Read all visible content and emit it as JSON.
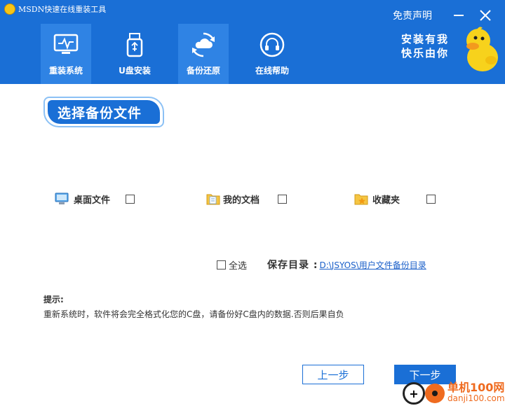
{
  "app": {
    "title": "MSDN快速在线重装工具"
  },
  "nav": [
    {
      "label": "重装系统",
      "icon": "monitor-pulse-icon",
      "active": true
    },
    {
      "label": "U盘安装",
      "icon": "usb-drive-icon",
      "active": false
    },
    {
      "label": "备份还原",
      "icon": "cloud-sync-icon",
      "active": true
    },
    {
      "label": "在线帮助",
      "icon": "headset-icon",
      "active": false
    }
  ],
  "header": {
    "disclaimer": "免责声明",
    "slogan_line1": "安装有我",
    "slogan_line2": "快乐由你"
  },
  "section": {
    "title": "选择备份文件"
  },
  "options": [
    {
      "label": "桌面文件",
      "icon": "desktop-icon",
      "checked": false
    },
    {
      "label": "我的文档",
      "icon": "documents-folder-icon",
      "checked": false
    },
    {
      "label": "收藏夹",
      "icon": "favorites-folder-icon",
      "checked": false
    }
  ],
  "select_all": {
    "label": "全选",
    "checked": false
  },
  "save": {
    "label": "保存目录 :",
    "path": "D:\\JSYOS\\用户文件备份目录"
  },
  "tip": {
    "title": "提示:",
    "text": "重新系统时，软件将会完全格式化您的C盘，请备份好C盘内的数据.否则后果自负"
  },
  "buttons": {
    "prev": "上一步",
    "next": "下一步"
  },
  "watermark": {
    "line1": "单机100网",
    "line2": "danji100.com",
    "plus": "+"
  },
  "colors": {
    "primary": "#1a6fd6",
    "active_tab": "#2f83e4",
    "link": "#1a5fc9",
    "watermark": "#ef6b1f"
  }
}
